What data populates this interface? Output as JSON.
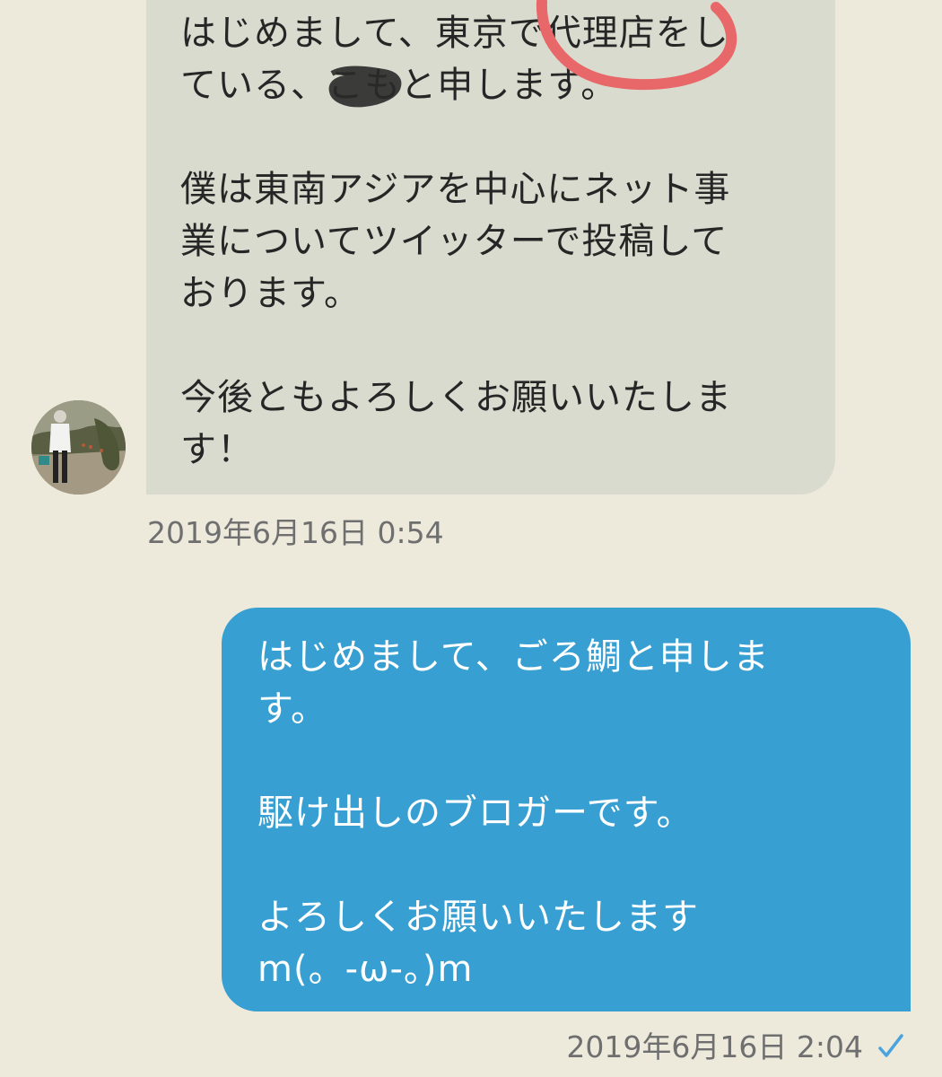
{
  "conversation": {
    "incoming": {
      "text": "はじめまして、東京で代理店をし\nている、こもと申します。\n\n僕は東南アジアを中心にネット事\n業についてツイッターで投稿して\nおります。\n\n今後ともよろしくお願いいたしま\nす！",
      "timestamp": "2019年6月16日 0:54",
      "avatar_icon": "user-avatar-photo"
    },
    "outgoing": {
      "text": "はじめまして、ごろ鯛と申しま\nす。\n\n駆け出しのブロガーです。\n\nよろしくお願いいたします\nm(。-ω-。)m",
      "timestamp": "2019年6月16日 2:04",
      "status_icon": "read-checkmark-icon"
    }
  },
  "colors": {
    "background": "#edeadc",
    "incoming_bubble": "#d9dbcf",
    "outgoing_bubble": "#379fd2",
    "outgoing_text": "#ffffff",
    "timestamp_text": "#6f6f6f",
    "annotation_circle": "#e8686a",
    "redaction": "#2a2a2a",
    "checkmark": "#4aa3df"
  }
}
